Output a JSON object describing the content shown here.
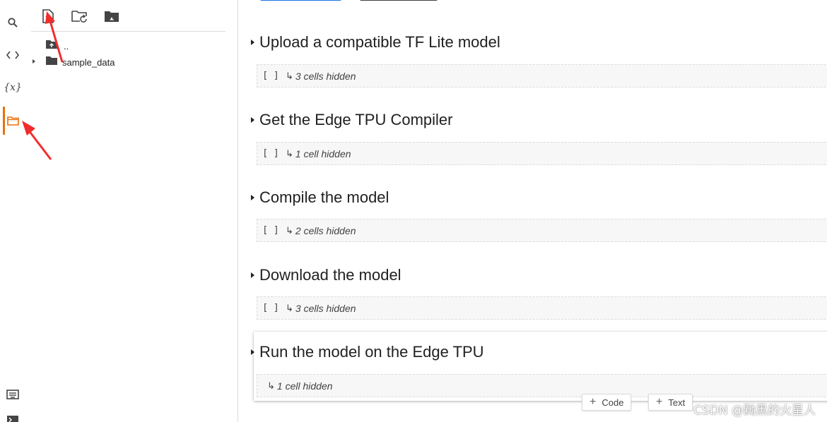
{
  "sidebar": {
    "items": [
      {
        "name": "search-icon"
      },
      {
        "name": "code-snippets-icon"
      },
      {
        "name": "variables-icon",
        "label": "{x}"
      },
      {
        "name": "files-icon",
        "active": true
      },
      {
        "name": "command-palette-icon"
      },
      {
        "name": "terminal-icon"
      }
    ],
    "active_color": "#e8710a"
  },
  "file_panel": {
    "toolbar": [
      {
        "name": "upload-file-icon"
      },
      {
        "name": "refresh-folder-icon"
      },
      {
        "name": "mount-drive-icon"
      }
    ],
    "tree": [
      {
        "label": "..",
        "icon": "parent-folder-icon"
      },
      {
        "label": "sample_data",
        "icon": "folder-icon",
        "expandable": true
      }
    ]
  },
  "notebook": {
    "sections": [
      {
        "title": "Upload a compatible TF Lite model",
        "run_label": "[ ]",
        "hidden_text": "3 cells hidden"
      },
      {
        "title": "Get the Edge TPU Compiler",
        "run_label": "[ ]",
        "hidden_text": "1 cell hidden"
      },
      {
        "title": "Compile the model",
        "run_label": "[ ]",
        "hidden_text": "2 cells hidden"
      },
      {
        "title": "Download the model",
        "run_label": "[ ]",
        "hidden_text": "3 cells hidden"
      },
      {
        "title": "Run the model on the Edge TPU",
        "run_label": "",
        "hidden_text": "1 cell hidden",
        "selected": true
      }
    ],
    "add_code_label": "Code",
    "add_text_label": "Text"
  },
  "watermark": "CSDN @黝黑的火星人",
  "colors": {
    "accent_orange": "#e8710a",
    "annotation_red": "#f22c2c",
    "cell_bg": "#f7f7f7"
  }
}
